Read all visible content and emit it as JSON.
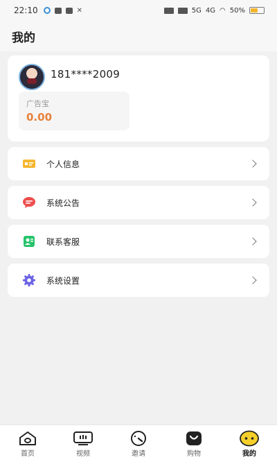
{
  "status_bar": {
    "time": "22:10",
    "battery": "50%",
    "network_1": "5G",
    "network_2": "4G"
  },
  "header": {
    "title": "我的"
  },
  "profile": {
    "phone": "181****2009",
    "wallet": {
      "label": "广告宝",
      "amount": "0.00"
    }
  },
  "menu": [
    {
      "label": "个人信息",
      "icon": "id-card-icon",
      "color": "#f5b731"
    },
    {
      "label": "系统公告",
      "icon": "message-icon",
      "color": "#ee4e4e"
    },
    {
      "label": "联系客服",
      "icon": "contact-icon",
      "color": "#25c36a"
    },
    {
      "label": "系统设置",
      "icon": "gear-icon",
      "color": "#6b63e6"
    }
  ],
  "tabbar": {
    "tabs": [
      {
        "label": "首页",
        "icon": "home-icon",
        "active": false
      },
      {
        "label": "视频",
        "icon": "video-icon",
        "active": false
      },
      {
        "label": "邀请",
        "icon": "invite-icon",
        "active": false
      },
      {
        "label": "购物",
        "icon": "shopping-icon",
        "active": false
      },
      {
        "label": "我的",
        "icon": "profile-face-icon",
        "active": true
      }
    ]
  }
}
